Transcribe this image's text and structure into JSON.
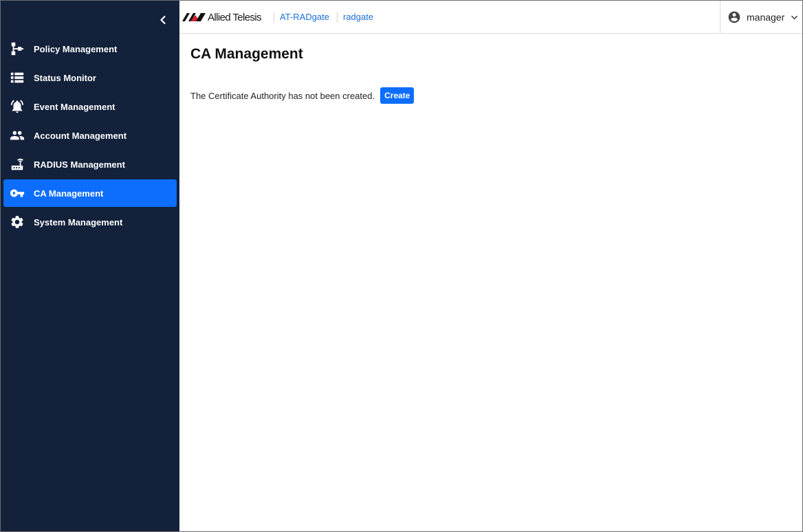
{
  "brand": {
    "logo_text": "Allied Telesis"
  },
  "breadcrumb": [
    "AT-RADgate",
    "radgate"
  ],
  "user": {
    "name": "manager"
  },
  "sidebar": {
    "items": [
      {
        "label": "Policy Management",
        "icon": "policy-icon"
      },
      {
        "label": "Status Monitor",
        "icon": "list-icon"
      },
      {
        "label": "Event Management",
        "icon": "bell-icon"
      },
      {
        "label": "Account Management",
        "icon": "people-icon"
      },
      {
        "label": "RADIUS Management",
        "icon": "router-icon"
      },
      {
        "label": "CA Management",
        "icon": "key-icon",
        "active": true
      },
      {
        "label": "System Management",
        "icon": "gear-icon"
      }
    ]
  },
  "main": {
    "title": "CA Management",
    "status_text": "The Certificate Authority has not been created.",
    "create_label": "Create"
  },
  "colors": {
    "sidebar_bg": "#13213b",
    "accent": "#0d6efd",
    "link": "#1a6fd6"
  }
}
